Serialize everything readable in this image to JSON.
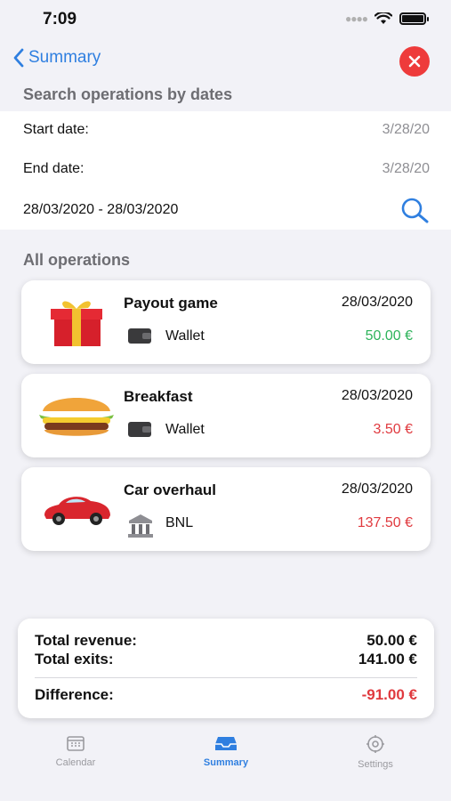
{
  "status": {
    "time": "7:09"
  },
  "nav": {
    "back_label": "Summary"
  },
  "search": {
    "header": "Search operations by dates",
    "start_label": "Start date:",
    "start_value": "3/28/20",
    "end_label": "End date:",
    "end_value": "3/28/20",
    "range_text": "28/03/2020 - 28/03/2020"
  },
  "operations_header": "All operations",
  "operations": [
    {
      "title": "Payout game",
      "date": "28/03/2020",
      "account": "Wallet",
      "amount": "50.00 €",
      "amount_color": "#2db35a",
      "image": "gift-icon",
      "account_icon": "wallet-icon"
    },
    {
      "title": "Breakfast",
      "date": "28/03/2020",
      "account": "Wallet",
      "amount": "3.50 €",
      "amount_color": "#e0393e",
      "image": "burger-icon",
      "account_icon": "wallet-icon"
    },
    {
      "title": "Car overhaul",
      "date": "28/03/2020",
      "account": "BNL",
      "amount": "137.50 €",
      "amount_color": "#e0393e",
      "image": "car-icon",
      "account_icon": "bank-icon"
    }
  ],
  "totals": {
    "revenue_label": "Total revenue:",
    "revenue_value": "50.00 €",
    "exits_label": "Total exits:",
    "exits_value": "141.00 €",
    "difference_label": "Difference:",
    "difference_value": "-91.00 €",
    "difference_color": "#e0393e"
  },
  "tabs": [
    {
      "label": "Calendar",
      "icon": "calendar-icon",
      "active": false
    },
    {
      "label": "Summary",
      "icon": "inbox-icon",
      "active": true
    },
    {
      "label": "Settings",
      "icon": "gear-icon",
      "active": false
    }
  ],
  "colors": {
    "accent": "#2f7fe0",
    "close": "#ee3b3b"
  }
}
